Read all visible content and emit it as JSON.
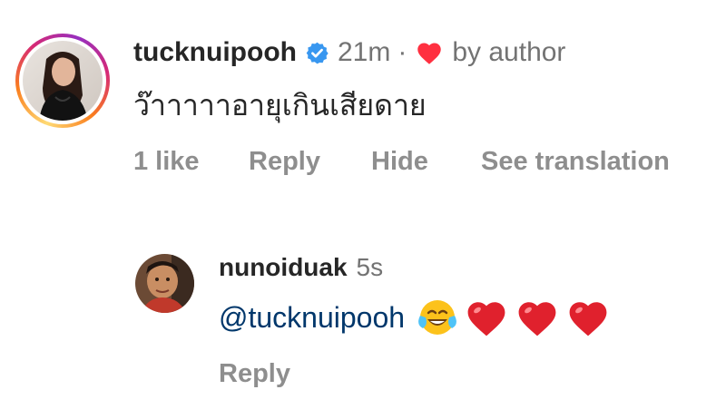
{
  "comment": {
    "username": "tucknuipooh",
    "time": "21m",
    "separator": "·",
    "author_like_label": "by author",
    "text": "ว๊าาาาาอายุเกินเสียดาย",
    "actions": {
      "likes": "1 like",
      "reply": "Reply",
      "hide": "Hide",
      "translate": "See translation"
    }
  },
  "reply": {
    "username": "nunoiduak",
    "time": "5s",
    "mention": "@tucknuipooh",
    "emojis": [
      "face-with-tears-of-joy",
      "red-heart",
      "red-heart",
      "red-heart"
    ],
    "actions": {
      "reply": "Reply"
    }
  },
  "colors": {
    "verified": "#3897f0",
    "heart": "#ff3040",
    "mention": "#00376b",
    "muted": "#8e8e8e"
  }
}
